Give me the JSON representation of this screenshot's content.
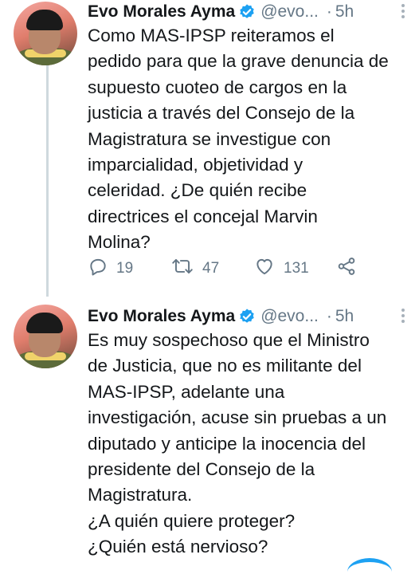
{
  "tweets": [
    {
      "author_name": "Evo Morales Ayma",
      "handle": "@evo...",
      "separator": "·",
      "time": "5h",
      "lines": [
        "Como MAS-IPSP reiteramos el",
        "pedido para que la grave denuncia de",
        "supuesto cuoteo de cargos en la",
        "justicia a través del Consejo de la",
        "Magistratura se investigue con",
        "imparcialidad, objetividad y",
        "celeridad. ¿De quién recibe",
        "directrices el concejal Marvin",
        "Molina?"
      ],
      "replies": "19",
      "retweets": "47",
      "likes": "131"
    },
    {
      "author_name": "Evo Morales Ayma",
      "handle": "@evo...",
      "separator": "·",
      "time": "5h",
      "lines": [
        "Es muy sospechoso que el Ministro",
        "de Justicia, que no es militante del",
        "MAS-IPSP, adelante una",
        "investigación, acuse sin pruebas a un",
        "diputado y anticipe la inocencia del",
        "presidente del Consejo de la",
        "Magistratura.",
        "¿A quién quiere proteger?",
        "¿Quién está nervioso?"
      ]
    }
  ],
  "icons": {
    "verified": "verified-badge-icon",
    "more": "more-vertical-icon",
    "reply": "reply-icon",
    "retweet": "retweet-icon",
    "like": "heart-icon",
    "share": "share-icon"
  },
  "colors": {
    "accent": "#1da1f2",
    "secondary_text": "#657786",
    "thread_line": "#cfd9de"
  }
}
